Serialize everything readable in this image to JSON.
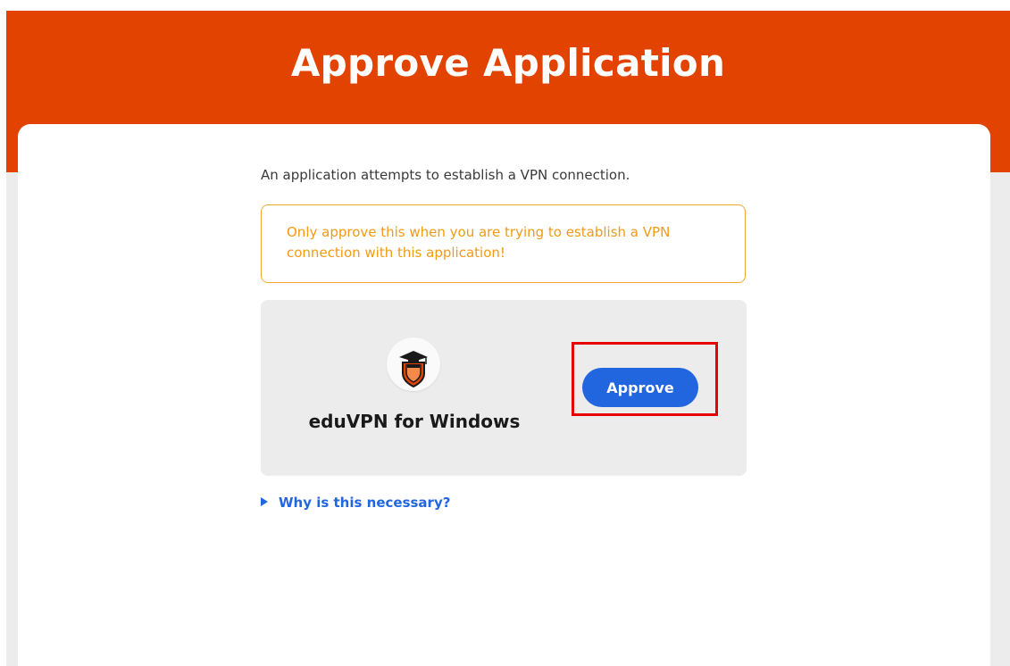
{
  "header": {
    "title": "Approve Application"
  },
  "main": {
    "intro_text": "An application attempts to establish a VPN connection.",
    "warning_text": "Only approve this when you are trying to establish a VPN connection with this application!",
    "app": {
      "name": "eduVPN for Windows",
      "logo_icon": "eduvpn-logo-icon"
    },
    "approve_label": "Approve",
    "why_link_label": "Why is this necessary?",
    "why_link_icon": "disclosure-triangle-icon"
  },
  "colors": {
    "brand_orange": "#e24300",
    "accent_blue": "#2166de",
    "warning_orange": "#f29a14",
    "highlight_red": "#e60000",
    "background_gray": "#ececec"
  }
}
